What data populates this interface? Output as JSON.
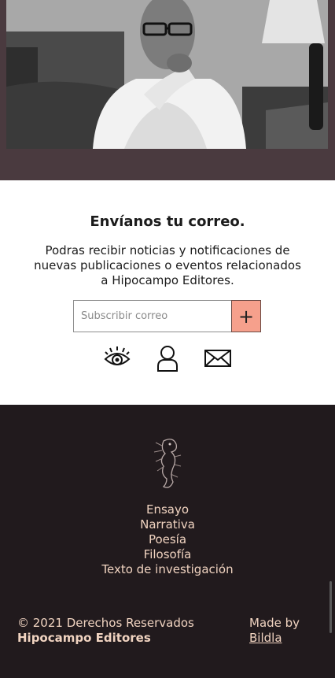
{
  "newsletter": {
    "title": "Envíanos tu correo.",
    "description": "Podras recibir noticias y notificaciones de nuevas publicaciones o eventos relacionados a Hipocampo Editores.",
    "input_placeholder": "Subscribir correo",
    "submit_label": "+",
    "icons": [
      "eye-icon",
      "user-icon",
      "mail-icon"
    ]
  },
  "footer": {
    "links": [
      "Ensayo",
      "Narrativa",
      "Poesía",
      "Filosofía",
      "Texto de investigación"
    ],
    "copyright": "© 2021 Derechos Reservados",
    "brand": "Hipocampo Editores",
    "made_by_label": "Made by",
    "made_by_link": "Bildla"
  },
  "colors": {
    "hero_band": "#4a3a3f",
    "submit_button": "#f6a08c",
    "footer_bg": "#211a1d",
    "footer_text": "#f0d3c0"
  }
}
